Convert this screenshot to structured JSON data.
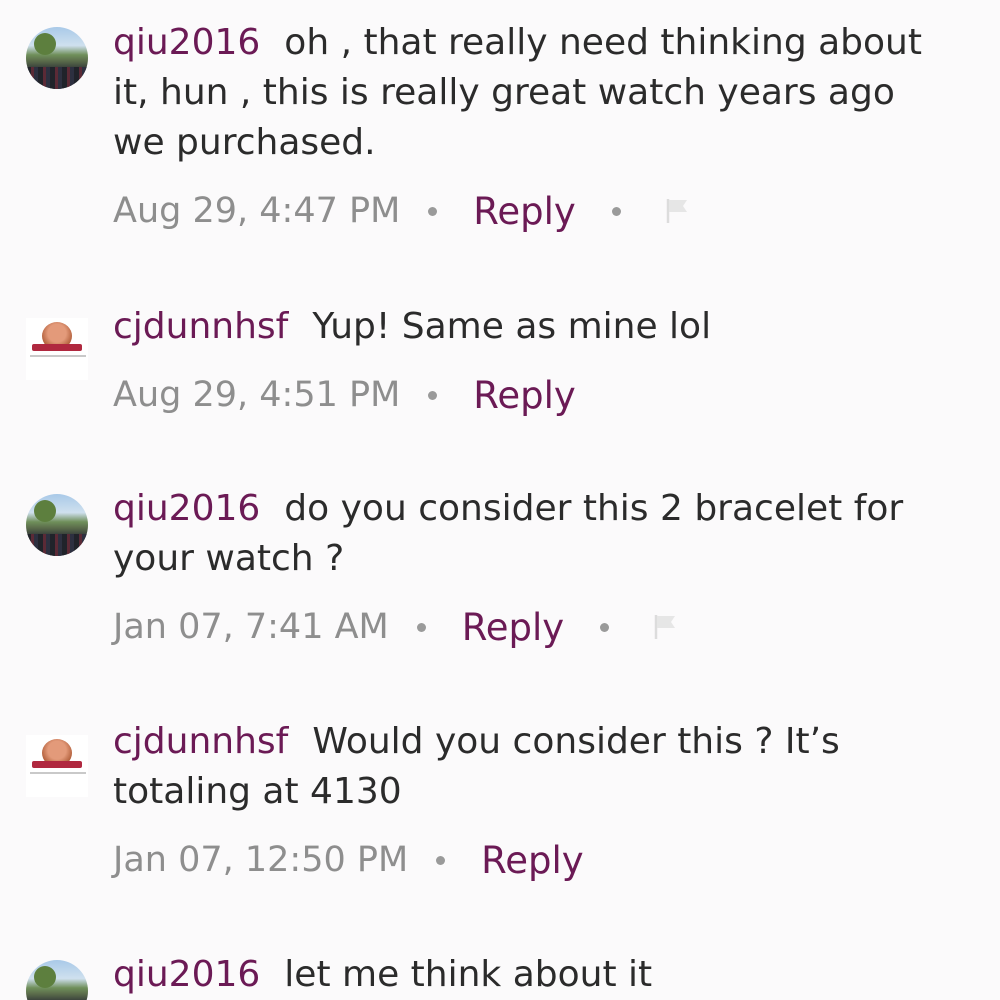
{
  "comments": [
    {
      "username": "qiu2016",
      "text": "oh , that really need thinking about it,  hun , this is really great watch years ago we purchased.",
      "time": "Aug 29, 4:47 PM",
      "reply": "Reply",
      "flag": true,
      "avatar": "photo"
    },
    {
      "username": "cjdunnhsf",
      "text": "Yup!  Same as mine lol",
      "time": "Aug 29, 4:51 PM",
      "reply": "Reply",
      "flag": false,
      "avatar": "badge"
    },
    {
      "username": "qiu2016",
      "text": "do you consider this 2 bracelet for your watch ?",
      "time": "Jan 07, 7:41 AM",
      "reply": "Reply",
      "flag": true,
      "avatar": "photo"
    },
    {
      "username": "cjdunnhsf",
      "text": "Would you consider this ? It’s totaling at 4130",
      "time": "Jan 07, 12:50 PM",
      "reply": "Reply",
      "flag": false,
      "avatar": "badge"
    },
    {
      "username": "qiu2016",
      "text": "let me think about it",
      "avatar": "photo"
    }
  ],
  "icons": {
    "flag": "flag-icon",
    "separator": "bullet-dot"
  },
  "colors": {
    "username": "#6b1a55",
    "reply": "#6b1a55",
    "timestamp": "#8e8e8e",
    "body_text": "#2b2b2b",
    "background": "#fbfafb"
  }
}
